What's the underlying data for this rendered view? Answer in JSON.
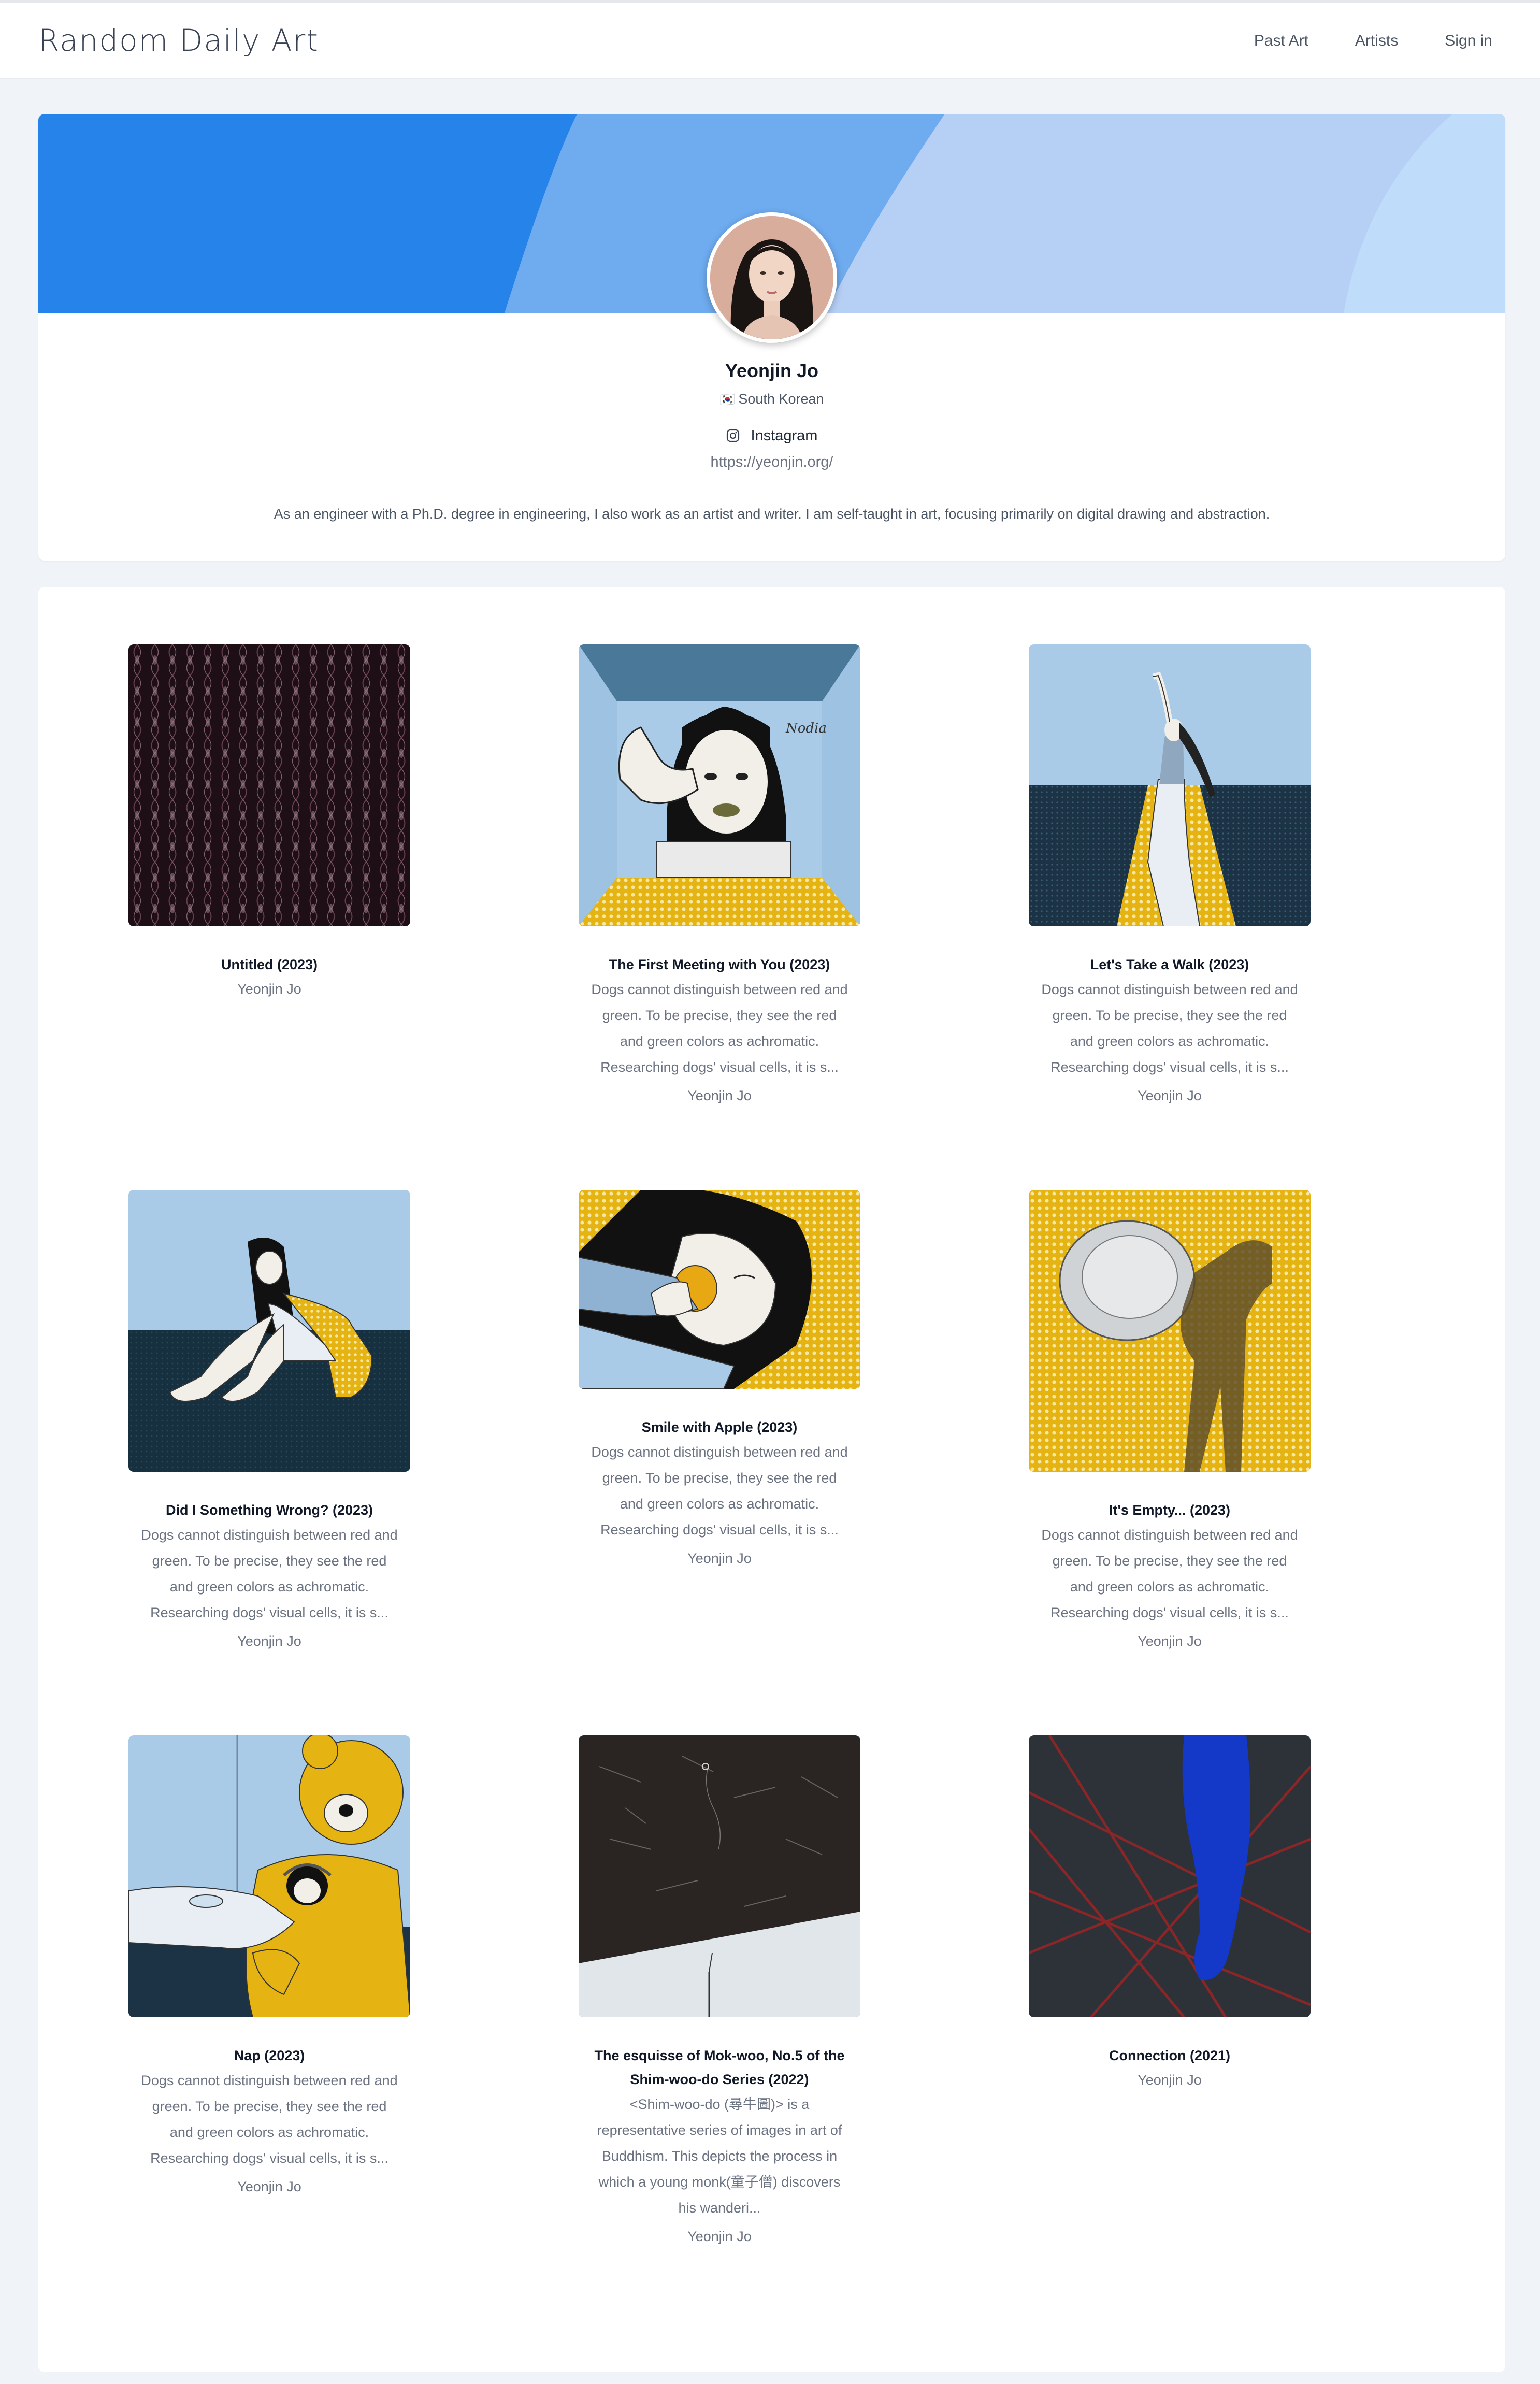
{
  "site": {
    "brand": "Random Daily Art",
    "nav": [
      {
        "label": "Past Art"
      },
      {
        "label": "Artists"
      },
      {
        "label": "Sign in"
      }
    ]
  },
  "profile": {
    "name": "Yeonjin Jo",
    "flag": "🇰🇷",
    "nationality": "South Korean",
    "social_label": "Instagram",
    "website": "https://yeonjin.org/",
    "bio": "As an engineer with a Ph.D. degree in engineering, I also work as an artist and writer. I am self-taught in art, focusing primarily on digital drawing and abstraction."
  },
  "artworks": [
    {
      "title": "Untitled (2023)",
      "desc": [],
      "artist": "Yeonjin Jo"
    },
    {
      "title": "The First Meeting with You (2023)",
      "desc": [
        "Dogs cannot distinguish between red and",
        "green. To be precise, they see the red",
        "and green colors as achromatic.",
        "Researching dogs' visual cells, it is s..."
      ],
      "artist": "Yeonjin Jo"
    },
    {
      "title": "Let's Take a Walk (2023)",
      "desc": [
        "Dogs cannot distinguish between red and",
        "green. To be precise, they see the red",
        "and green colors as achromatic.",
        "Researching dogs' visual cells, it is s..."
      ],
      "artist": "Yeonjin Jo"
    },
    {
      "title": "Did I Something Wrong? (2023)",
      "desc": [
        "Dogs cannot distinguish between red and",
        "green. To be precise, they see the red",
        "and green colors as achromatic.",
        "Researching dogs' visual cells, it is s..."
      ],
      "artist": "Yeonjin Jo"
    },
    {
      "title": "Smile with Apple (2023)",
      "desc": [
        "Dogs cannot distinguish between red and",
        "green. To be precise, they see the red",
        "and green colors as achromatic.",
        "Researching dogs' visual cells, it is s..."
      ],
      "artist": "Yeonjin Jo"
    },
    {
      "title": "It's Empty... (2023)",
      "desc": [
        "Dogs cannot distinguish between red and",
        "green. To be precise, they see the red",
        "and green colors as achromatic.",
        "Researching dogs' visual cells, it is s..."
      ],
      "artist": "Yeonjin Jo"
    },
    {
      "title": "Nap (2023)",
      "desc": [
        "Dogs cannot distinguish between red and",
        "green. To be precise, they see the red",
        "and green colors as achromatic.",
        "Researching dogs' visual cells, it is s..."
      ],
      "artist": "Yeonjin Jo"
    },
    {
      "title_lines": [
        "The esquisse of Mok-woo, No.5 of the",
        "Shim-woo-do Series (2022)"
      ],
      "desc": [
        "<Shim-woo-do (尋牛圖)> is a",
        "representative series of images in art of",
        "Buddhism. This depicts the process in",
        "which a young monk(童子僧) discovers",
        "his wanderi..."
      ],
      "artist": "Yeonjin Jo"
    },
    {
      "title": "Connection (2021)",
      "desc": [],
      "artist": "Yeonjin Jo"
    }
  ],
  "colors": {
    "banner_primary": "#2583e9",
    "banner_mid": "#6eabef",
    "banner_light": "#b6d3f6",
    "banner_pale": "#bfdcfb",
    "halftone_yellow": "#e5b413",
    "navy": "#183041"
  },
  "icons": [
    "instagram-icon"
  ]
}
